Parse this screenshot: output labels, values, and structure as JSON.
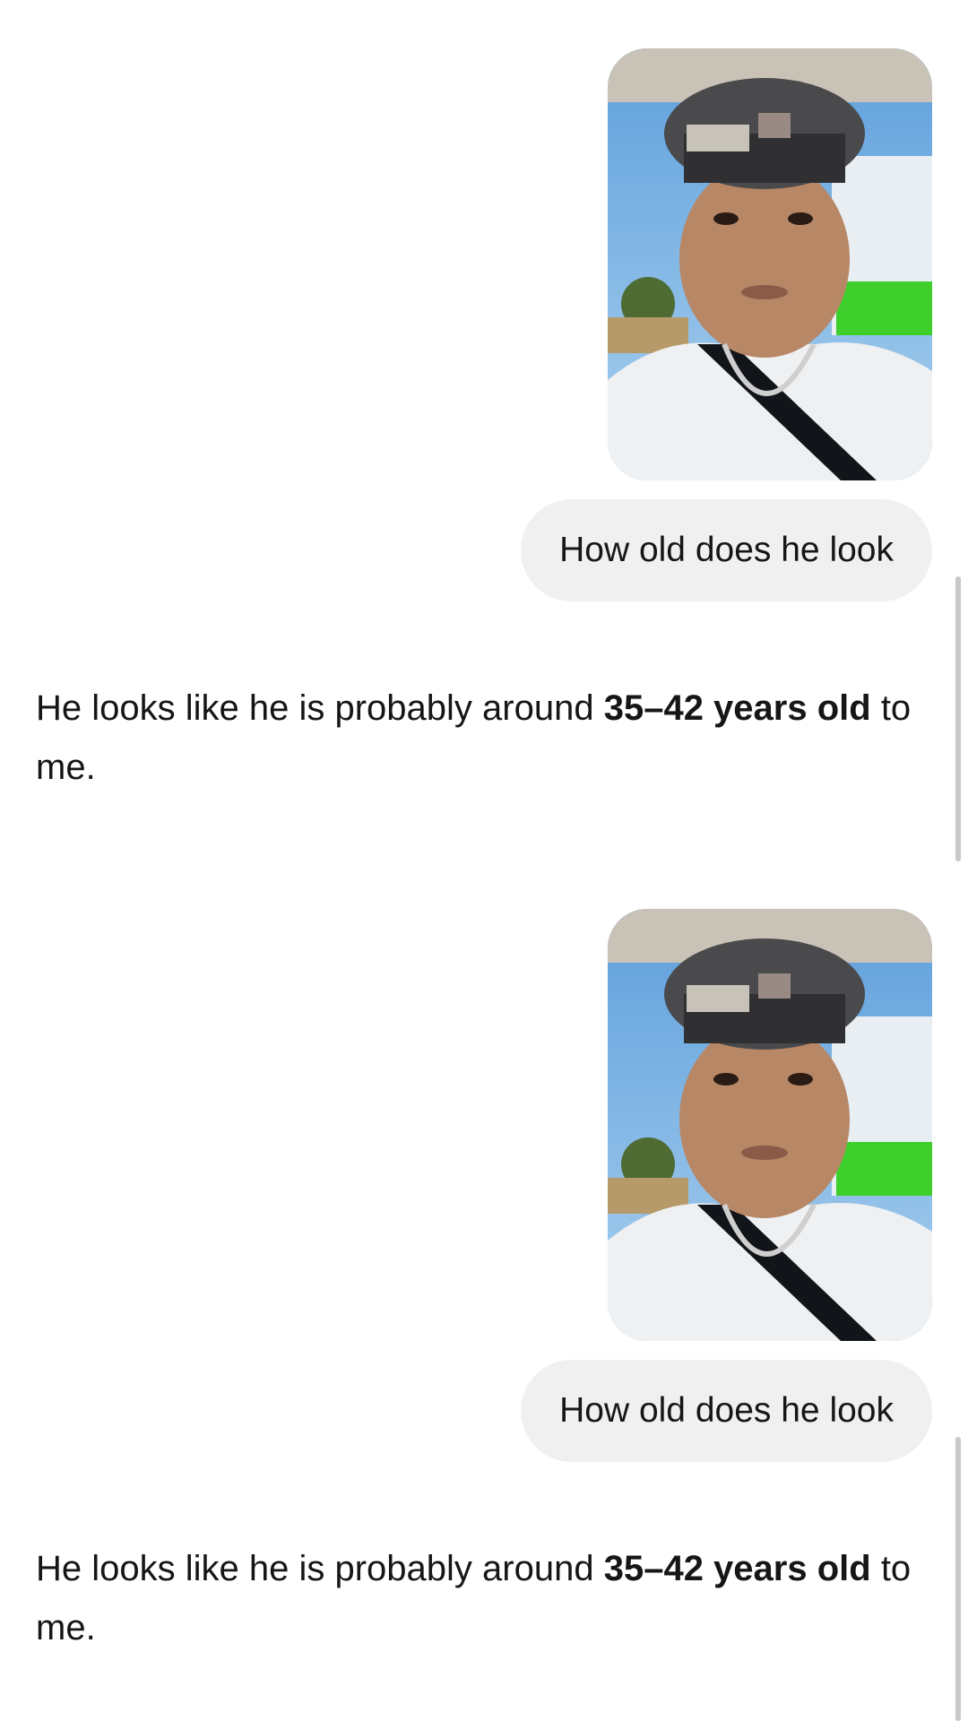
{
  "conversation": {
    "messages": [
      {
        "role": "user",
        "attachment": "selfie-photo",
        "text": "How old does he look"
      },
      {
        "role": "assistant",
        "text_before": "He looks like he is probably around ",
        "text_bold": "35–42 years old",
        "text_after": " to me."
      },
      {
        "role": "user",
        "attachment": "selfie-photo",
        "text": "How old does he look"
      },
      {
        "role": "assistant",
        "text_before": "He looks like he is probably around ",
        "text_bold": "35–42 years old",
        "text_after": " to me."
      }
    ]
  },
  "colors": {
    "background": "#ffffff",
    "user_bubble": "#f0f0f0",
    "text": "#161616",
    "scrollbar": "#c8c8c8"
  }
}
